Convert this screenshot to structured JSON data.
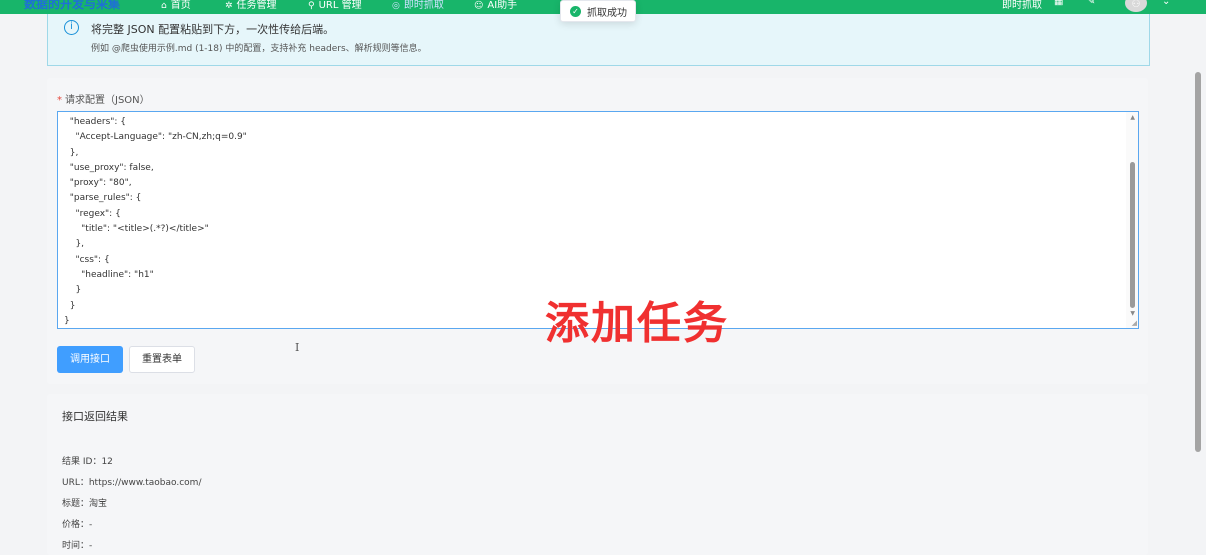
{
  "app": {
    "brand": "数据的开发与采集",
    "nav": [
      {
        "icon": "⌂",
        "label": "首页"
      },
      {
        "icon": "✲",
        "label": "任务管理"
      },
      {
        "icon": "⚲",
        "label": "URL 管理"
      },
      {
        "icon": "◎",
        "label": "即时抓取"
      },
      {
        "icon": "☺",
        "label": "AI助手"
      }
    ],
    "right_label": "即时抓取",
    "avatar_icon": "user-avatar",
    "accent_color": "#18b56a"
  },
  "toast": {
    "text": "抓取成功"
  },
  "alert": {
    "line1": "将完整 JSON 配置粘贴到下方，一次性传给后端。",
    "line2": "例如 @爬虫使用示例.md (1-18) 中的配置，支持补充 headers、解析规则等信息。"
  },
  "form": {
    "label": "请求配置（JSON）",
    "required_mark": "*",
    "json_text": "  \"headers\": {\n    \"Accept-Language\": \"zh-CN,zh;q=0.9\"\n  },\n  \"use_proxy\": false,\n  \"proxy\": \"80\",\n  \"parse_rules\": {\n    \"regex\": {\n      \"title\": \"<title>(.*?)</title>\"\n    },\n    \"css\": {\n      \"headline\": \"h1\"\n    }\n  }\n}",
    "submit_label": "调用接口",
    "reset_label": "重置表单"
  },
  "overlay_text": "添加任务",
  "result": {
    "title": "接口返回结果",
    "rows": [
      "结果 ID：12",
      "URL：https://www.taobao.com/",
      "标题：淘宝",
      "价格：-",
      "时间：-"
    ]
  }
}
